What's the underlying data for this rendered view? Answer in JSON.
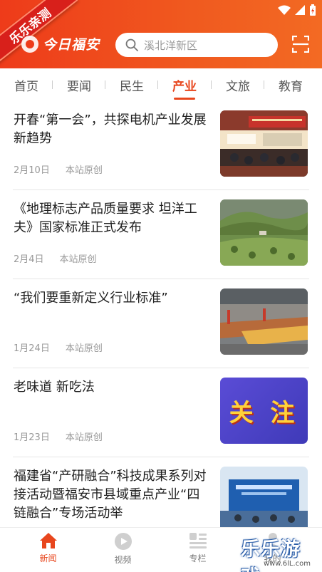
{
  "header": {
    "ribbon_text": "乐乐亲测",
    "logo_text": "今日福安",
    "search_placeholder": "溪北洋新区",
    "colors": {
      "primary": "#ee3b1a",
      "accent": "#e8461d"
    }
  },
  "tabs": [
    {
      "label": "首页"
    },
    {
      "label": "要闻"
    },
    {
      "label": "民生"
    },
    {
      "label": "产业",
      "active": true
    },
    {
      "label": "文旅"
    },
    {
      "label": "教育"
    }
  ],
  "news": [
    {
      "title": "开春“第一会”，共探电机产业发展新趋势",
      "date": "2月10日",
      "source": "本站原创",
      "image": "conference-photo"
    },
    {
      "title": "《地理标志产品质量要求 坦洋工夫》国家标准正式发布",
      "date": "2月4日",
      "source": "本站原创",
      "image": "tea-garden-photo"
    },
    {
      "title": "“我们要重新定义行业标准”",
      "date": "1月24日",
      "source": "本站原创",
      "image": "factory-photo"
    },
    {
      "title": "老味道 新吃法",
      "date": "1月23日",
      "source": "本站原创",
      "image": "guanzhu-banner",
      "image_text": "关 注"
    },
    {
      "title": "福建省“产研融合”科技成果系列对接活动暨福安市县域重点产业“四链融合”专场活动举",
      "date": "",
      "source": "",
      "image": "stage-event-photo"
    }
  ],
  "bottom_nav": [
    {
      "label": "新闻",
      "icon": "home-icon",
      "active": true
    },
    {
      "label": "视频",
      "icon": "play-icon"
    },
    {
      "label": "专栏",
      "icon": "column-icon"
    },
    {
      "label": "我的",
      "icon": "user-icon"
    }
  ],
  "watermark": {
    "text": "乐乐游戏",
    "url": "www.6lL.com"
  }
}
